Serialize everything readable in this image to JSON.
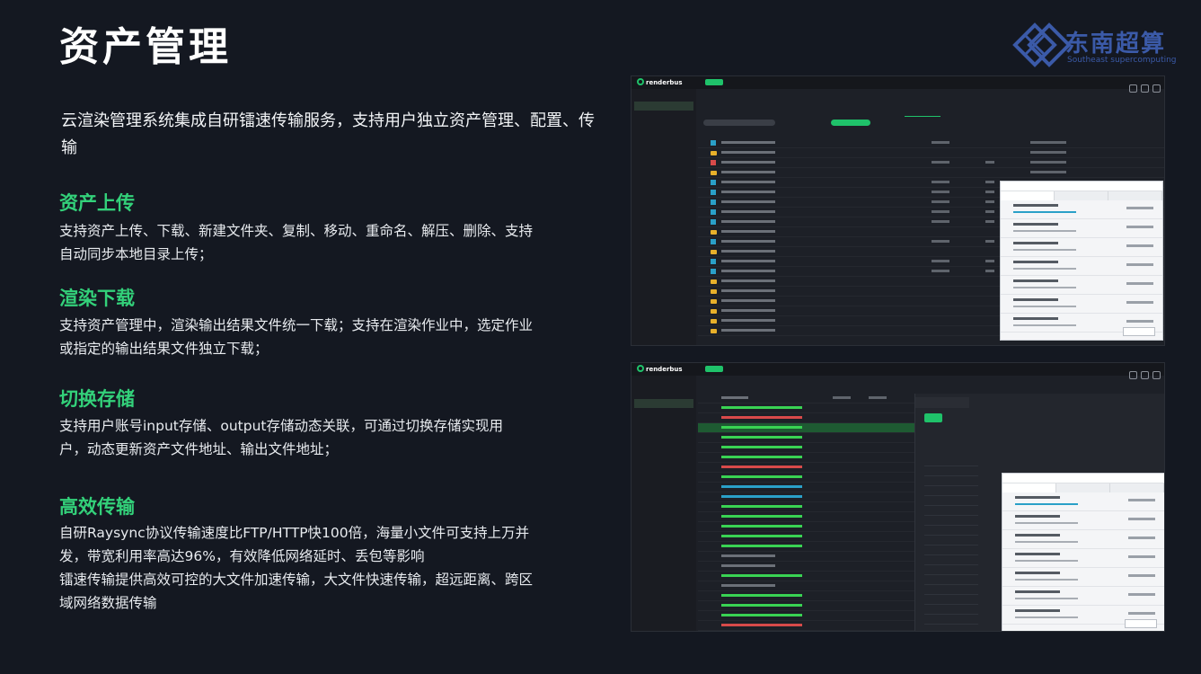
{
  "page": {
    "title": "资产管理",
    "intro": "云渲染管理系统集成自研镭速传输服务，支持用户独立资产管理、配置、传输"
  },
  "logo": {
    "name": "东南超算",
    "subtitle": "Southeast supercomputing"
  },
  "sections": [
    {
      "heading": "资产上传",
      "body": "支持资产上传、下载、新建文件夹、复制、移动、重命名、解压、删除、支持自动同步本地目录上传；"
    },
    {
      "heading": "渲染下载",
      "body": "支持资产管理中，渲染输出结果文件统一下载；支持在渲染作业中，选定作业或指定的输出结果文件独立下载；"
    },
    {
      "heading": "切换存储",
      "body": "支持用户账号input存储、output存储动态关联，可通过切换存储实现用户，动态更新资产文件地址、输出文件地址；"
    },
    {
      "heading": "高效传输",
      "body1": "自研Raysync协议传输速度比FTP/HTTP快100倍，海量小文件可支持上万并发，带宽利用率高达96%，有效降低网络延时、丢包等影响",
      "body2": "镭速传输提供高效可控的大文件加速传输，大文件快速传输，超远距离、跨区域网络数据传输"
    }
  ],
  "screenshots": {
    "app_name": "renderbus",
    "accent": "#1fc26a"
  },
  "colors": {
    "background": "#141821",
    "heading_green": "#33d17a",
    "logo_blue": "#3b5aa8"
  }
}
